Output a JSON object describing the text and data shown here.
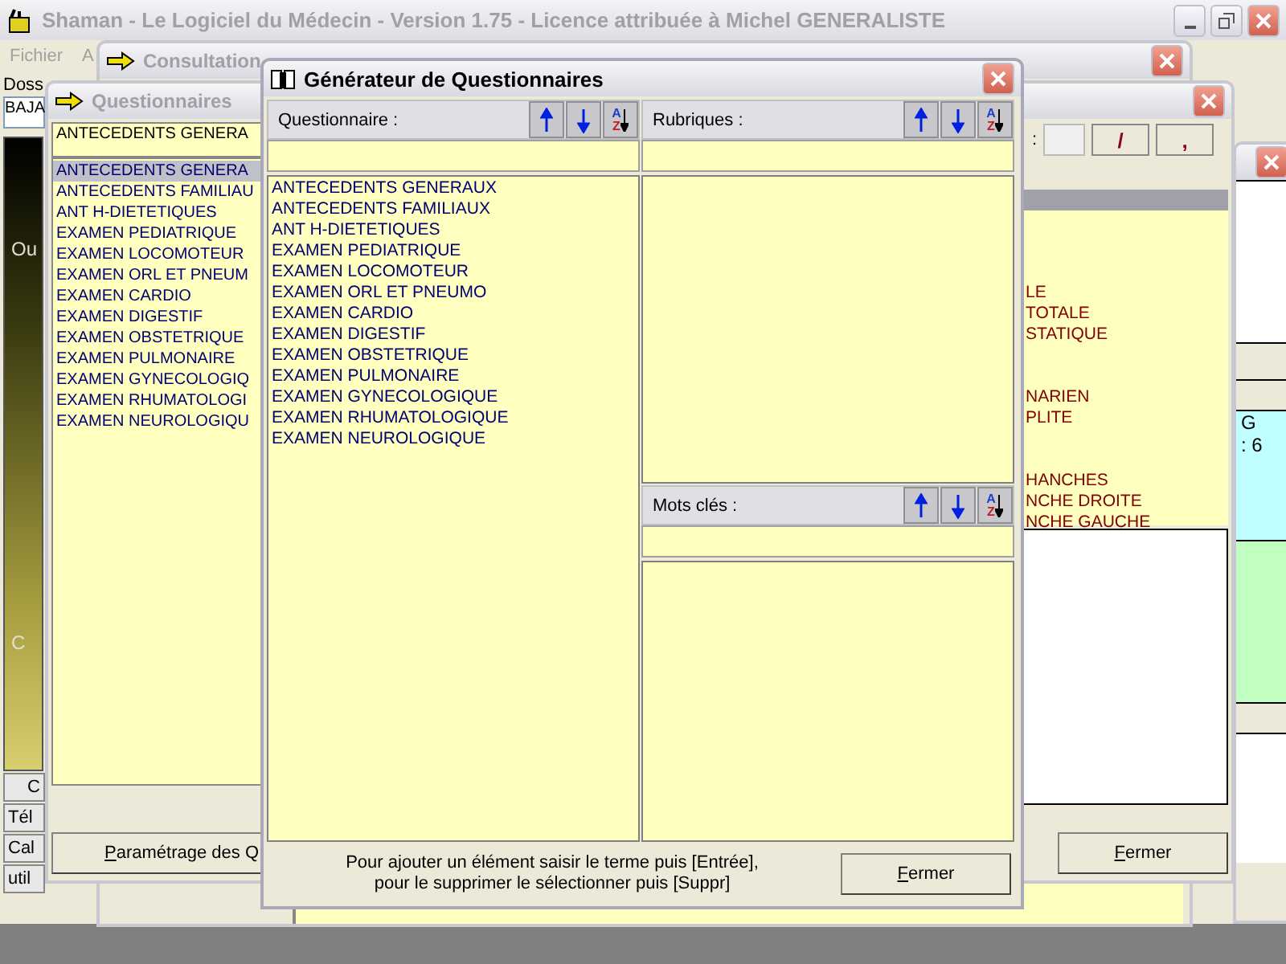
{
  "main_window": {
    "title": "Shaman - Le Logiciel du Médecin - Version 1.75 - Licence attribuée à Michel GENERALISTE",
    "menu": [
      "Fichier",
      "A"
    ],
    "sidebar": {
      "label": "Doss",
      "field_value": "BAJA",
      "panel_labels": [
        "Ou",
        "C"
      ],
      "buttons": [
        "C",
        "Tél",
        "Cal",
        "util"
      ]
    }
  },
  "consultation_window": {
    "title": "Consultation"
  },
  "questionnaires_window": {
    "title": "Questionnaires",
    "combo_value": "ANTECEDENTS GENERA",
    "list": [
      {
        "label": "ANTECEDENTS GENERA",
        "selected": true
      },
      {
        "label": "ANTECEDENTS FAMILIAU",
        "selected": false
      },
      {
        "label": "ANT H-DIETETIQUES",
        "selected": false
      },
      {
        "label": "EXAMEN PEDIATRIQUE",
        "selected": false
      },
      {
        "label": "EXAMEN LOCOMOTEUR",
        "selected": false
      },
      {
        "label": "EXAMEN ORL ET PNEUM",
        "selected": false
      },
      {
        "label": "EXAMEN CARDIO",
        "selected": false
      },
      {
        "label": "EXAMEN DIGESTIF",
        "selected": false
      },
      {
        "label": "EXAMEN OBSTETRIQUE",
        "selected": false
      },
      {
        "label": "EXAMEN PULMONAIRE",
        "selected": false
      },
      {
        "label": "EXAMEN GYNECOLOGIQ",
        "selected": false
      },
      {
        "label": "EXAMEN RHUMATOLOGI",
        "selected": false
      },
      {
        "label": "EXAMEN NEUROLOGIQU",
        "selected": false
      }
    ],
    "settings_button": "Paramétrage des Q",
    "toolbar": {
      "label": ":",
      "buttons": [
        "/",
        ","
      ]
    },
    "rubric_groups": [
      [
        "LE",
        "TOTALE",
        "STATIQUE"
      ],
      [
        "NARIEN",
        "PLITE"
      ],
      [
        "HANCHES",
        "NCHE DROITE",
        "NCHE GAUCHE"
      ]
    ],
    "close_button": "Fermer"
  },
  "side_window": {
    "lines": [
      "G",
      ": 6"
    ]
  },
  "generator_dialog": {
    "title": "Générateur de Questionnaires",
    "questionnaire_panel": {
      "label": "Questionnaire :",
      "sort_letters": [
        "A",
        "Z"
      ],
      "items": [
        "ANTECEDENTS GENERAUX",
        "ANTECEDENTS FAMILIAUX",
        "ANT H-DIETETIQUES",
        "EXAMEN PEDIATRIQUE",
        "EXAMEN LOCOMOTEUR",
        "EXAMEN ORL ET PNEUMO",
        "EXAMEN CARDIO",
        "EXAMEN DIGESTIF",
        "EXAMEN OBSTETRIQUE",
        "EXAMEN PULMONAIRE",
        "EXAMEN GYNECOLOGIQUE",
        "EXAMEN RHUMATOLOGIQUE",
        "EXAMEN NEUROLOGIQUE"
      ]
    },
    "rubriques_panel": {
      "label": "Rubriques :",
      "sort_letters": [
        "A",
        "Z"
      ]
    },
    "keywords_panel": {
      "label": "Mots clés :",
      "sort_letters": [
        "A",
        "Z"
      ]
    },
    "hint": [
      "Pour ajouter un élément saisir le terme puis [Entrée],",
      "pour le supprimer le sélectionner puis [Suppr]"
    ],
    "close_button": "Fermer"
  }
}
